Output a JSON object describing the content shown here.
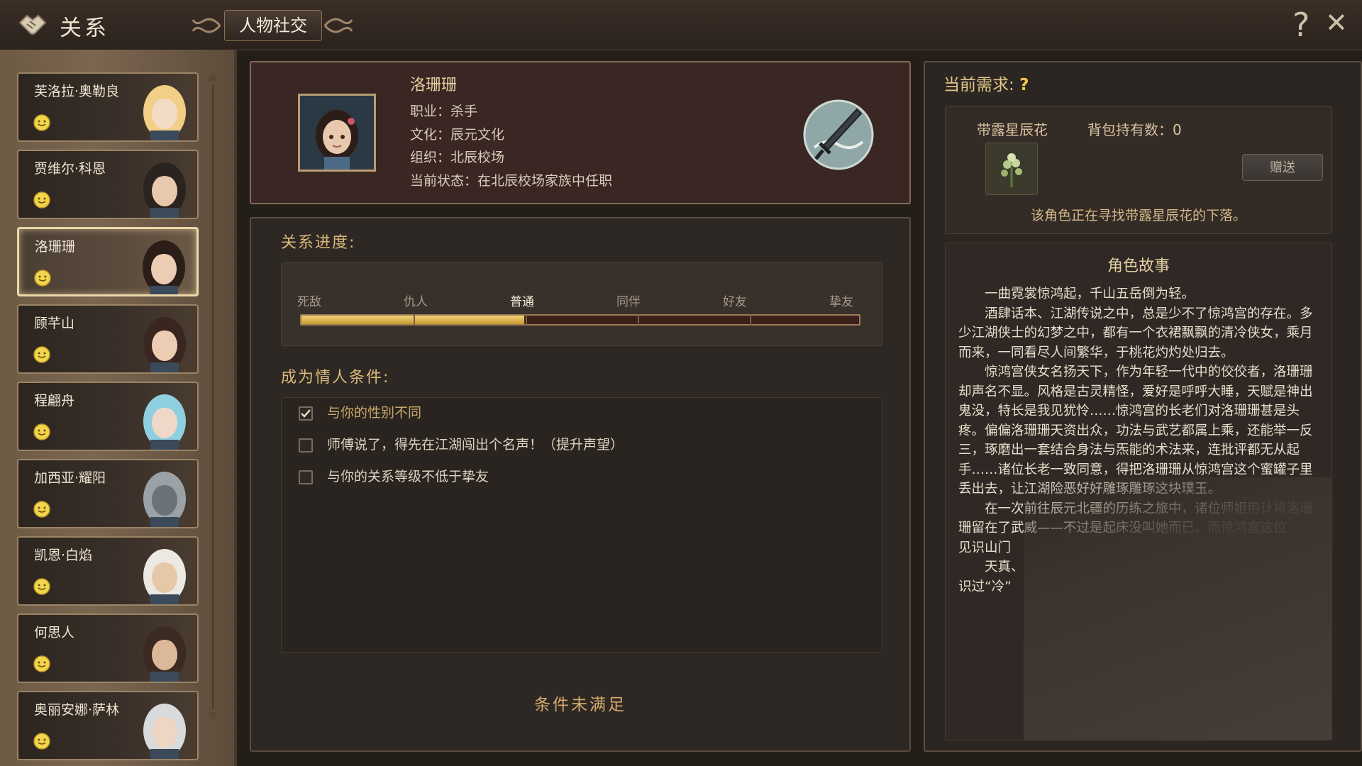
{
  "topbar": {
    "section_title": "关系",
    "tab_label": "人物社交",
    "help_glyph": "?",
    "close_glyph": "✕"
  },
  "characters": [
    {
      "name": "芙洛拉·奥勒良",
      "mood": "smile-icon",
      "selected": false
    },
    {
      "name": "贾维尔·科恩",
      "mood": "smile-icon",
      "selected": false
    },
    {
      "name": "洛珊珊",
      "mood": "smile-icon",
      "selected": true
    },
    {
      "name": "顾芊山",
      "mood": "smile-icon",
      "selected": false
    },
    {
      "name": "程翩舟",
      "mood": "smile-icon",
      "selected": false
    },
    {
      "name": "加西亚·耀阳",
      "mood": "smile-icon",
      "selected": false
    },
    {
      "name": "凯恩·白焰",
      "mood": "smile-icon",
      "selected": false
    },
    {
      "name": "何思人",
      "mood": "smile-icon",
      "selected": false
    },
    {
      "name": "奥丽安娜·萨林",
      "mood": "smile-icon",
      "selected": false
    }
  ],
  "profile": {
    "name": "洛珊珊",
    "job": "职业：杀手",
    "culture": "文化：辰元文化",
    "organization": "组织：北辰校场",
    "status": "当前状态：在北辰校场家族中任职"
  },
  "relationship": {
    "title": "关系进度:",
    "levels": [
      "死敌",
      "仇人",
      "普通",
      "同伴",
      "好友",
      "挚友"
    ],
    "current_level": "普通",
    "progress_fraction": 0.4
  },
  "lover": {
    "title": "成为情人条件:",
    "conditions": [
      {
        "text": "与你的性别不同",
        "met": true
      },
      {
        "text": "师傅说了，得先在江湖闯出个名声！（提升声望）",
        "met": false
      },
      {
        "text": "与你的关系等级不低于挚友",
        "met": false
      }
    ],
    "status": "条件未满足"
  },
  "demand": {
    "title": "当前需求:",
    "mark": "?",
    "item_name": "带露星辰花",
    "bag_count": "背包持有数：0",
    "gift_button": "赠送",
    "description": "该角色正在寻找带露星辰花的下落。"
  },
  "story": {
    "title": "角色故事",
    "paragraphs": [
      "一曲霓裳惊鸿起，千山五岳倒为轻。",
      "酒肆话本、江湖传说之中，总是少不了惊鸿宫的存在。多少江湖侠士的幻梦之中，都有一个衣裙飘飘的清冷侠女，乘月而来，一同看尽人间繁华，于桃花灼灼处归去。",
      "惊鸿宫侠女名扬天下，作为年轻一代中的佼佼者，洛珊珊却声名不显。风格是古灵精怪，爱好是呼呼大睡，天赋是神出鬼没，特长是我见犹怜……惊鸿宫的长老们对洛珊珊甚是头疼。偏偏洛珊珊天资出众，功法与武艺都属上乘，还能举一反三，琢磨出一套结合身法与炁能的术法来，连批评都无从起手……诸位长老一致同意，得把洛珊珊从惊鸿宫这个蜜罐子里丢出去，让江湖险恶好好雕琢雕琢这块璞玉。",
      "在一次前往辰元北疆的历练之旅中，诸位师姐用计将洛珊珊留在了武威——不过是起床没叫她而已。而惊鸿宫这位",
      "见识山门",
      "天真、",
      "识过“冷”"
    ]
  },
  "colors": {
    "accent_gold": "#d9b87a",
    "progress_fill": "#e3b94a",
    "profile_bg": "#3a2723"
  }
}
